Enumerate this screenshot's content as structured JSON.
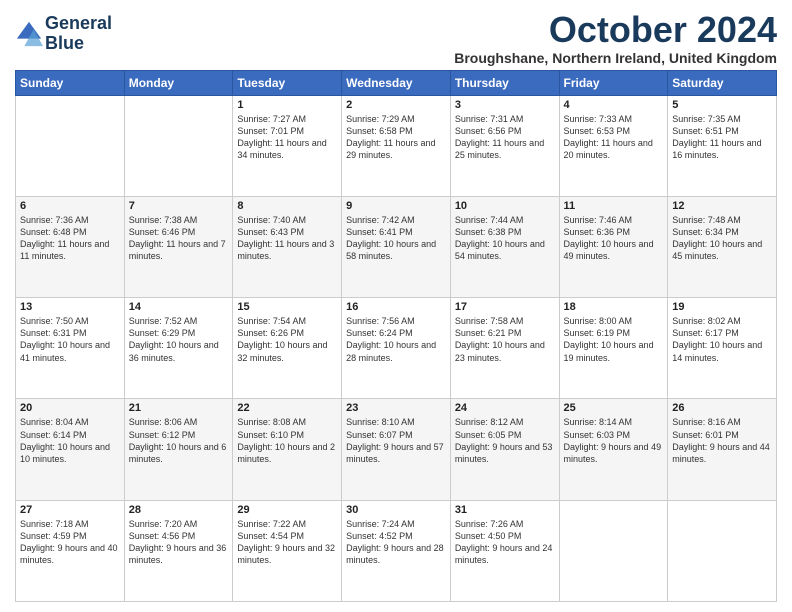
{
  "header": {
    "logo_line1": "General",
    "logo_line2": "Blue",
    "month": "October 2024",
    "location": "Broughshane, Northern Ireland, United Kingdom"
  },
  "weekdays": [
    "Sunday",
    "Monday",
    "Tuesday",
    "Wednesday",
    "Thursday",
    "Friday",
    "Saturday"
  ],
  "weeks": [
    [
      {
        "day": "",
        "content": ""
      },
      {
        "day": "",
        "content": ""
      },
      {
        "day": "1",
        "content": "Sunrise: 7:27 AM\nSunset: 7:01 PM\nDaylight: 11 hours and 34 minutes."
      },
      {
        "day": "2",
        "content": "Sunrise: 7:29 AM\nSunset: 6:58 PM\nDaylight: 11 hours and 29 minutes."
      },
      {
        "day": "3",
        "content": "Sunrise: 7:31 AM\nSunset: 6:56 PM\nDaylight: 11 hours and 25 minutes."
      },
      {
        "day": "4",
        "content": "Sunrise: 7:33 AM\nSunset: 6:53 PM\nDaylight: 11 hours and 20 minutes."
      },
      {
        "day": "5",
        "content": "Sunrise: 7:35 AM\nSunset: 6:51 PM\nDaylight: 11 hours and 16 minutes."
      }
    ],
    [
      {
        "day": "6",
        "content": "Sunrise: 7:36 AM\nSunset: 6:48 PM\nDaylight: 11 hours and 11 minutes."
      },
      {
        "day": "7",
        "content": "Sunrise: 7:38 AM\nSunset: 6:46 PM\nDaylight: 11 hours and 7 minutes."
      },
      {
        "day": "8",
        "content": "Sunrise: 7:40 AM\nSunset: 6:43 PM\nDaylight: 11 hours and 3 minutes."
      },
      {
        "day": "9",
        "content": "Sunrise: 7:42 AM\nSunset: 6:41 PM\nDaylight: 10 hours and 58 minutes."
      },
      {
        "day": "10",
        "content": "Sunrise: 7:44 AM\nSunset: 6:38 PM\nDaylight: 10 hours and 54 minutes."
      },
      {
        "day": "11",
        "content": "Sunrise: 7:46 AM\nSunset: 6:36 PM\nDaylight: 10 hours and 49 minutes."
      },
      {
        "day": "12",
        "content": "Sunrise: 7:48 AM\nSunset: 6:34 PM\nDaylight: 10 hours and 45 minutes."
      }
    ],
    [
      {
        "day": "13",
        "content": "Sunrise: 7:50 AM\nSunset: 6:31 PM\nDaylight: 10 hours and 41 minutes."
      },
      {
        "day": "14",
        "content": "Sunrise: 7:52 AM\nSunset: 6:29 PM\nDaylight: 10 hours and 36 minutes."
      },
      {
        "day": "15",
        "content": "Sunrise: 7:54 AM\nSunset: 6:26 PM\nDaylight: 10 hours and 32 minutes."
      },
      {
        "day": "16",
        "content": "Sunrise: 7:56 AM\nSunset: 6:24 PM\nDaylight: 10 hours and 28 minutes."
      },
      {
        "day": "17",
        "content": "Sunrise: 7:58 AM\nSunset: 6:21 PM\nDaylight: 10 hours and 23 minutes."
      },
      {
        "day": "18",
        "content": "Sunrise: 8:00 AM\nSunset: 6:19 PM\nDaylight: 10 hours and 19 minutes."
      },
      {
        "day": "19",
        "content": "Sunrise: 8:02 AM\nSunset: 6:17 PM\nDaylight: 10 hours and 14 minutes."
      }
    ],
    [
      {
        "day": "20",
        "content": "Sunrise: 8:04 AM\nSunset: 6:14 PM\nDaylight: 10 hours and 10 minutes."
      },
      {
        "day": "21",
        "content": "Sunrise: 8:06 AM\nSunset: 6:12 PM\nDaylight: 10 hours and 6 minutes."
      },
      {
        "day": "22",
        "content": "Sunrise: 8:08 AM\nSunset: 6:10 PM\nDaylight: 10 hours and 2 minutes."
      },
      {
        "day": "23",
        "content": "Sunrise: 8:10 AM\nSunset: 6:07 PM\nDaylight: 9 hours and 57 minutes."
      },
      {
        "day": "24",
        "content": "Sunrise: 8:12 AM\nSunset: 6:05 PM\nDaylight: 9 hours and 53 minutes."
      },
      {
        "day": "25",
        "content": "Sunrise: 8:14 AM\nSunset: 6:03 PM\nDaylight: 9 hours and 49 minutes."
      },
      {
        "day": "26",
        "content": "Sunrise: 8:16 AM\nSunset: 6:01 PM\nDaylight: 9 hours and 44 minutes."
      }
    ],
    [
      {
        "day": "27",
        "content": "Sunrise: 7:18 AM\nSunset: 4:59 PM\nDaylight: 9 hours and 40 minutes."
      },
      {
        "day": "28",
        "content": "Sunrise: 7:20 AM\nSunset: 4:56 PM\nDaylight: 9 hours and 36 minutes."
      },
      {
        "day": "29",
        "content": "Sunrise: 7:22 AM\nSunset: 4:54 PM\nDaylight: 9 hours and 32 minutes."
      },
      {
        "day": "30",
        "content": "Sunrise: 7:24 AM\nSunset: 4:52 PM\nDaylight: 9 hours and 28 minutes."
      },
      {
        "day": "31",
        "content": "Sunrise: 7:26 AM\nSunset: 4:50 PM\nDaylight: 9 hours and 24 minutes."
      },
      {
        "day": "",
        "content": ""
      },
      {
        "day": "",
        "content": ""
      }
    ]
  ]
}
